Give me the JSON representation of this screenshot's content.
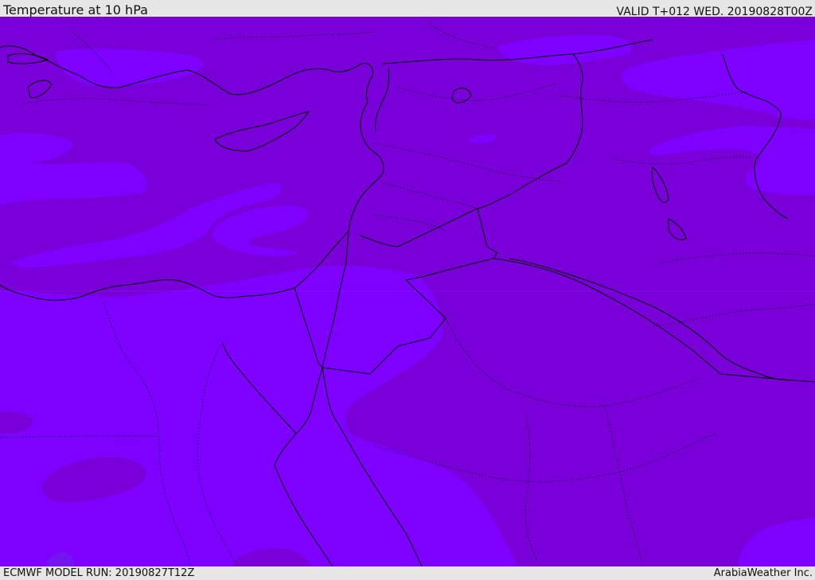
{
  "header": {
    "title": "Temperature at 10 hPa",
    "valid": "VALID T+012 WED. 20190828T00Z"
  },
  "footer": {
    "model_run": "ECMWF MODEL RUN: 20190827T12Z",
    "credit": "ArabiaWeather Inc."
  },
  "colors": {
    "band_warm": "#7a00d9",
    "band_cool": "#7e00ff",
    "band_coldest": "#7414f0",
    "coastline": "#000000",
    "frame": "#e6e6e6"
  }
}
